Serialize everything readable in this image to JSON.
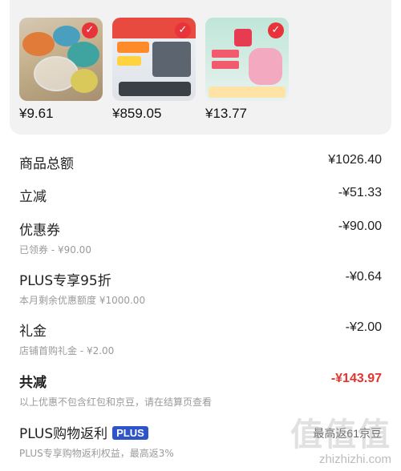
{
  "goods": {
    "items": [
      {
        "price": "¥9.61"
      },
      {
        "price": "¥859.05"
      },
      {
        "price": "¥13.77"
      }
    ]
  },
  "summary": {
    "total_goods": {
      "label": "商品总额",
      "value": "¥1026.40"
    },
    "instant_discount": {
      "label": "立减",
      "value": "-¥51.33"
    },
    "coupon": {
      "label": "优惠券",
      "value": "-¥90.00",
      "sub": "已领券 - ¥90.00"
    },
    "plus95": {
      "label": "PLUS专享95折",
      "value": "-¥0.64",
      "sub": "本月剩余优惠额度 ¥1000.00"
    },
    "gift": {
      "label": "礼金",
      "value": "-¥2.00",
      "sub": "店铺首购礼金 - ¥2.00"
    },
    "total_discount": {
      "label": "共减",
      "value": "-¥143.97",
      "sub": "以上优惠不包含红包和京豆，请在结算页查看"
    },
    "plus_rebate": {
      "label": "PLUS购物返利",
      "badge": "PLUS",
      "sub": "PLUS专享购物返利权益，最高返3%",
      "value": "最高返61京豆"
    }
  },
  "watermark": {
    "logo": "值值值",
    "url": "zhizhizhi.com"
  },
  "colors": {
    "accent_red": "#e5322d",
    "plus_blue": "#2d55c9"
  }
}
